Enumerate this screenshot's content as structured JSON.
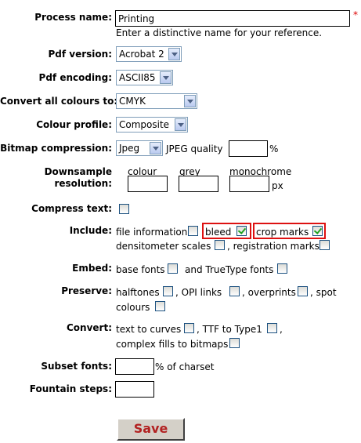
{
  "process_name": {
    "label": "Process name:",
    "value": "Printing",
    "required_mark": "*",
    "hint": "Enter a distinctive name for your reference."
  },
  "pdf_version": {
    "label": "Pdf version:",
    "selected": "Acrobat 2"
  },
  "pdf_encoding": {
    "label": "Pdf encoding:",
    "selected": "ASCII85"
  },
  "convert_colours": {
    "label": "Convert all colours to:",
    "selected": "CMYK"
  },
  "colour_profile": {
    "label": "Colour profile:",
    "selected": "Composite"
  },
  "bitmap": {
    "label": "Bitmap compression:",
    "selected": "Jpeg",
    "quality_label": "JPEG quality",
    "quality_value": "",
    "unit": "%"
  },
  "downsample": {
    "label_line1": "Downsample",
    "label_line2": "resolution:",
    "colour": "colour",
    "grey": "grey",
    "monochrome": "monochrome",
    "unit": "px",
    "colour_value": "",
    "grey_value": "",
    "mono_value": ""
  },
  "compress_text": {
    "label": "Compress text:",
    "checked": false
  },
  "include": {
    "label": "Include:",
    "file_information": "file information",
    "bleed": "bleed",
    "crop_marks": "crop marks",
    "densitometer": "densitometer scales",
    "registration": ", registration marks",
    "checked": {
      "file_information": false,
      "bleed": true,
      "crop_marks": true,
      "densitometer": false,
      "registration": false
    }
  },
  "embed": {
    "label": "Embed:",
    "base_fonts": "base fonts",
    "truetype": "and TrueType fonts"
  },
  "preserve": {
    "label": "Preserve:",
    "halftones": "halftones",
    "opi": ", OPI links",
    "overprints": ", overprints",
    "spot": ", spot",
    "colours": "colours"
  },
  "convert": {
    "label": "Convert:",
    "text_to_curves": "text to curves",
    "ttf": ", TTF to Type1",
    "comma": ",",
    "complex": "complex fills to bitmaps"
  },
  "subset_fonts": {
    "label": "Subset fonts:",
    "suffix": "% of charset",
    "value": ""
  },
  "fountain_steps": {
    "label": "Fountain steps:",
    "value": ""
  },
  "save_label": "Save",
  "colors": {
    "required": "#dd0000",
    "highlight_border": "#dd1111",
    "save_text": "#b22222",
    "checkbox_check": "#21a121"
  }
}
